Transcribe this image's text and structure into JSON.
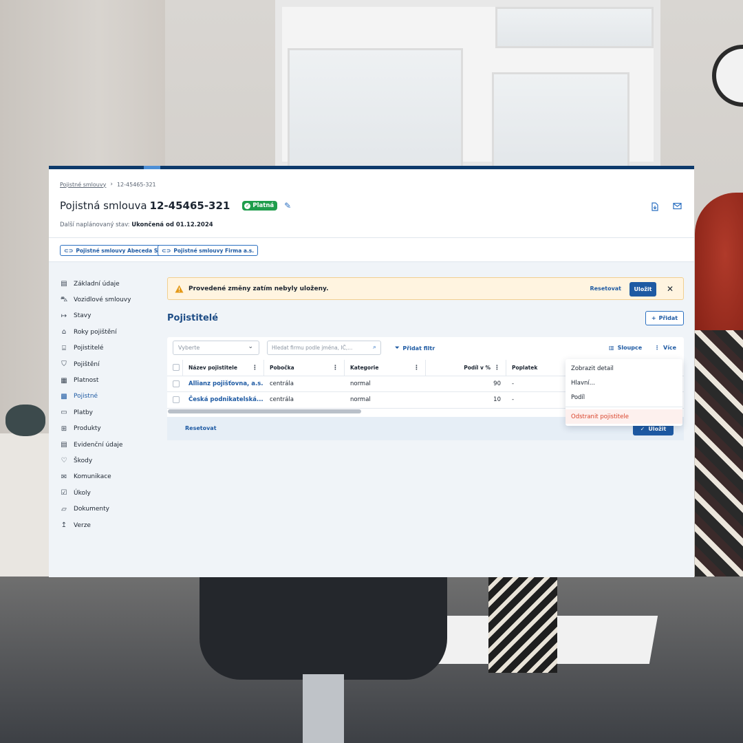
{
  "breadcrumb": {
    "parent": "Pojistné smlouvy",
    "current": "12-45465-321"
  },
  "header": {
    "title_prefix": "Pojistná smlouva",
    "title_number": "12-45465-321",
    "status_badge": "Platná",
    "next_state_label": "Další naplánovaný stav:",
    "next_state_value": "Ukončená od 01.12.2024",
    "icons": [
      "file-download-icon",
      "mail-icon"
    ]
  },
  "links": [
    "Pojistné smlouvy Abeceda SK",
    "Pojistné smlouvy Firma a.s."
  ],
  "sidebar": {
    "items": [
      {
        "label": "Základní údaje",
        "icon": "clipboard-icon"
      },
      {
        "label": "Vozidlové smlouvy",
        "icon": "car-icon"
      },
      {
        "label": "Stavy",
        "icon": "arrow-bar-icon"
      },
      {
        "label": "Roky pojištění",
        "icon": "cake-icon"
      },
      {
        "label": "Pojistitelé",
        "icon": "bank-icon"
      },
      {
        "label": "Pojištění",
        "icon": "shield-icon"
      },
      {
        "label": "Platnost",
        "icon": "calendar-icon"
      },
      {
        "label": "Pojistné",
        "icon": "calculator-icon"
      },
      {
        "label": "Platby",
        "icon": "document-icon"
      },
      {
        "label": "Produkty",
        "icon": "grid-icon"
      },
      {
        "label": "Evidenční údaje",
        "icon": "ledger-icon"
      },
      {
        "label": "Škody",
        "icon": "heart-icon"
      },
      {
        "label": "Komunikace",
        "icon": "mail-icon"
      },
      {
        "label": "Úkoly",
        "icon": "checklist-icon"
      },
      {
        "label": "Dokumenty",
        "icon": "folder-icon"
      },
      {
        "label": "Verze",
        "icon": "version-icon"
      }
    ],
    "active_index": 7,
    "active_color": "#1e5aa3"
  },
  "alert": {
    "message": "Provedené změny zatím nebyly uloženy.",
    "reset_label": "Resetovat",
    "save_label": "Uložit"
  },
  "section": {
    "title": "Pojistitelé",
    "add_label": "Přidat"
  },
  "toolbar": {
    "select_placeholder": "Vyberte",
    "search_placeholder": "Hledat firmu podle jména, IČ,...",
    "add_filter_label": "Přidat filtr",
    "columns_label": "Sloupce",
    "more_label": "Více"
  },
  "table": {
    "columns": [
      "Název pojistitele",
      "Pobočka",
      "Kategorie",
      "Podíl v %",
      "Poplatek"
    ],
    "rows": [
      {
        "name": "Allianz pojišťovna, a.s.",
        "branch": "centrála",
        "category": "normal",
        "share": "90",
        "fee": "-"
      },
      {
        "name": "Česká podnikatelská...",
        "branch": "centrála",
        "category": "normal",
        "share": "10",
        "fee": "-"
      }
    ]
  },
  "footer": {
    "reset_label": "Resetovat",
    "save_label": "Uložit"
  },
  "context_menu": {
    "items": [
      "Zobrazit detail",
      "Hlavní...",
      "Podíl"
    ],
    "danger_item": "Odstranit pojistitele"
  },
  "colors": {
    "brand": "#0d3a6b",
    "accent": "#1e5aa3",
    "success": "#1f9d4c",
    "warning": "#e49a1a",
    "danger": "#d9432b"
  }
}
